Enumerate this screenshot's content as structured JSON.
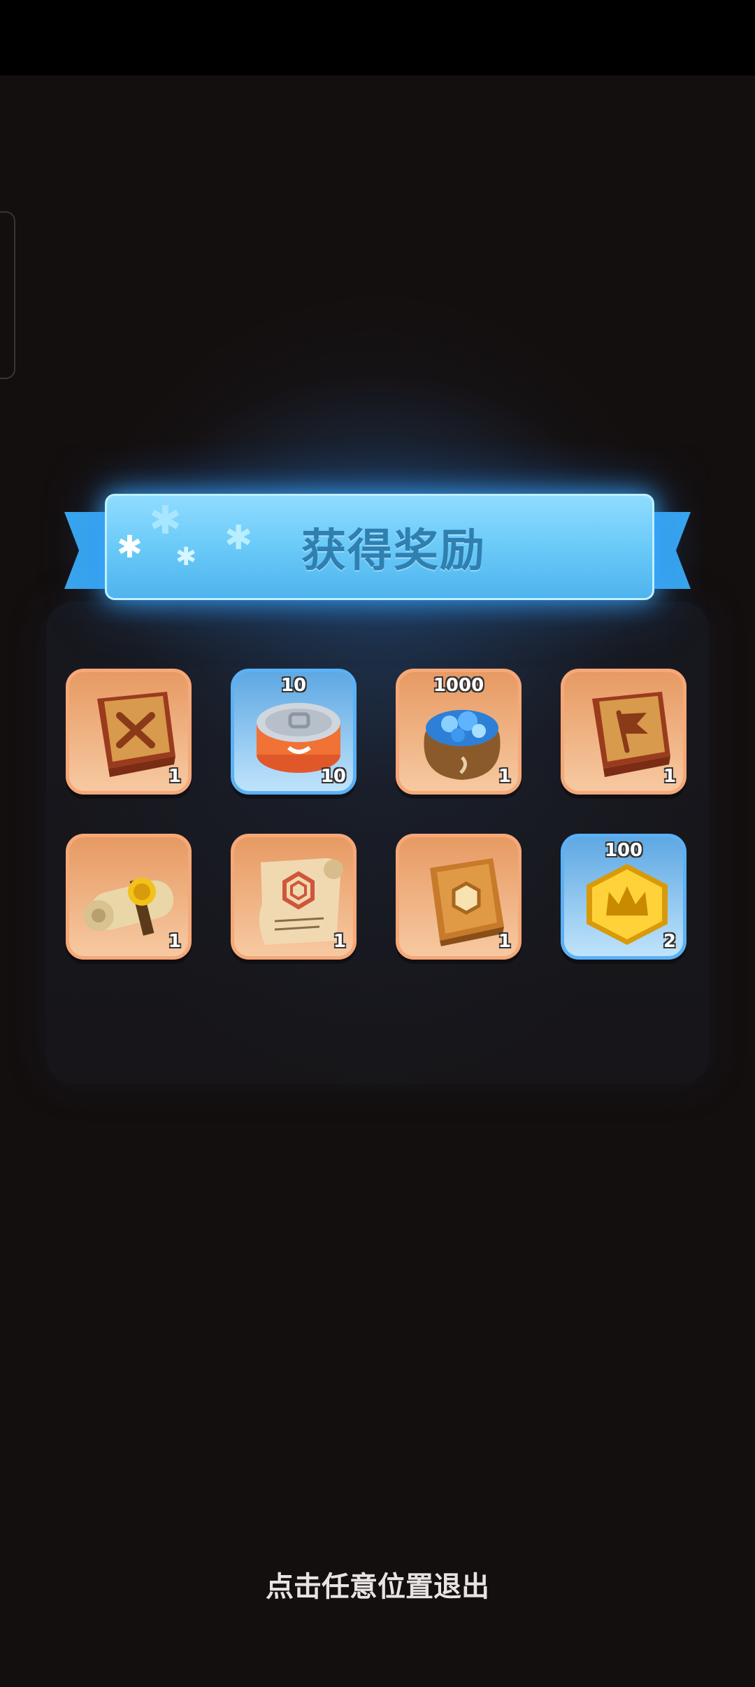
{
  "header": {
    "title": "获得奖励"
  },
  "rewards": [
    {
      "icon": "weapon-manual-book-icon",
      "top_value": "",
      "quantity": "1",
      "tier": "orange"
    },
    {
      "icon": "canned-food-icon",
      "top_value": "10",
      "quantity": "10",
      "tier": "blue"
    },
    {
      "icon": "gem-sack-icon",
      "top_value": "1000",
      "quantity": "1",
      "tier": "orange"
    },
    {
      "icon": "flag-manual-book-icon",
      "top_value": "",
      "quantity": "1",
      "tier": "orange"
    },
    {
      "icon": "sealed-scroll-icon",
      "top_value": "",
      "quantity": "1",
      "tier": "orange"
    },
    {
      "icon": "blueprint-scroll-icon",
      "top_value": "",
      "quantity": "1",
      "tier": "orange"
    },
    {
      "icon": "hexagon-book-icon",
      "top_value": "",
      "quantity": "1",
      "tier": "orange"
    },
    {
      "icon": "crown-hex-token-icon",
      "top_value": "100",
      "quantity": "2",
      "tier": "blue"
    }
  ],
  "footer": {
    "exit_hint": "点击任意位置退出"
  },
  "colors": {
    "ribbon": "#67c8f7",
    "orange_tile": "#f6a878",
    "blue_tile": "#5bb1f6"
  }
}
